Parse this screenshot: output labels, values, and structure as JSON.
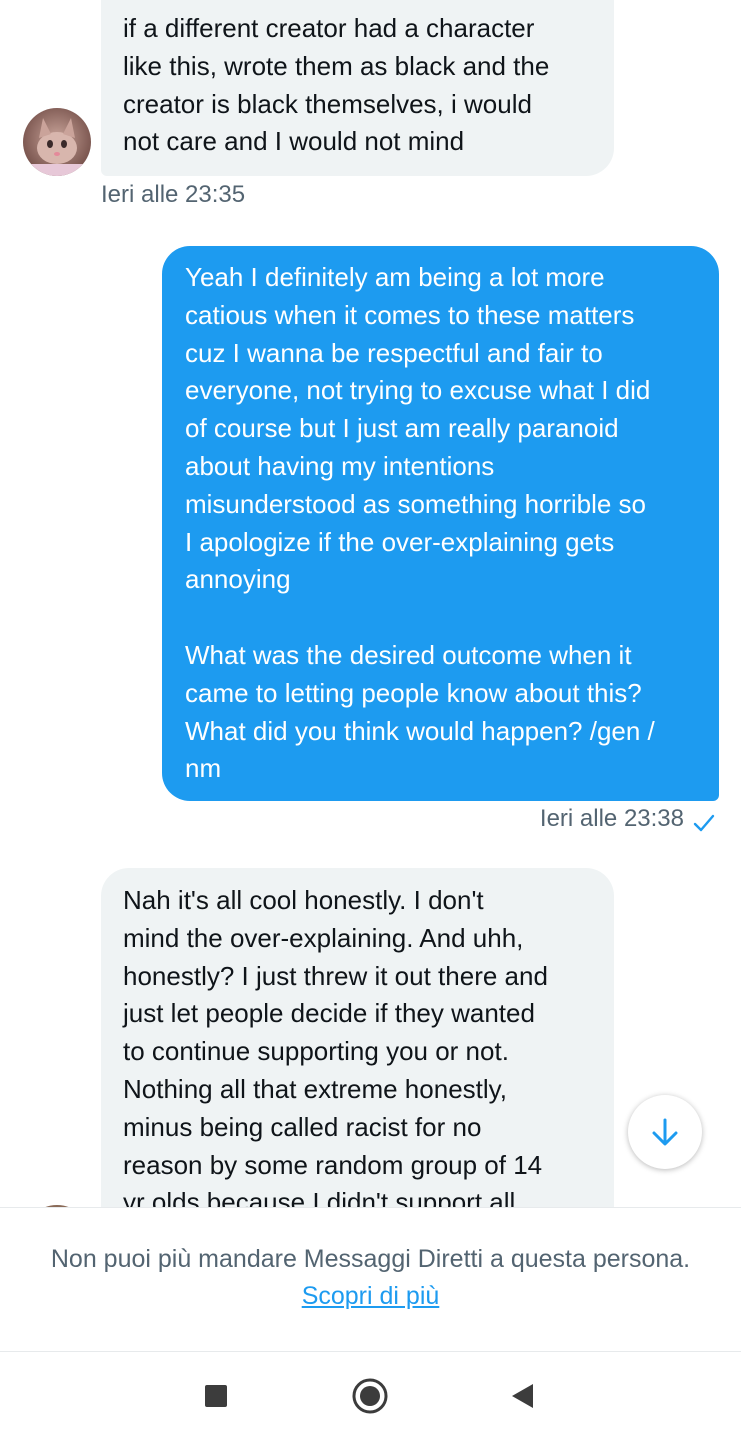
{
  "messages": [
    {
      "direction": "incoming",
      "text": "if a different creator had a character\nlike this, wrote them as black and the\ncreator is black themselves, i would\nnot care and I would not mind",
      "timestamp": "Ieri alle 23:35"
    },
    {
      "direction": "outgoing",
      "text": "Yeah I definitely am being a lot more\ncatious when it comes to these matters\ncuz I wanna be respectful and fair to\neveryone, not trying to excuse what I did\nof course but I just am really paranoid\nabout having my intentions\nmisunderstood as something horrible so\nI apologize if the over-explaining gets\nannoying\n\nWhat was the desired outcome when it\ncame to letting people know about this?\nWhat did you think would happen? /gen /\nnm",
      "timestamp": "Ieri alle 23:38",
      "status_icon": "check-icon"
    },
    {
      "direction": "incoming",
      "text": "Nah it's all cool honestly. I don't\nmind the over-explaining. And uhh,\nhonestly? I just threw it out there and\njust let people decide if they wanted\nto continue supporting you or not.\nNothing all that extreme honestly,\nminus being called racist for no\nreason by some random group of 14\nyr olds because I didn't support all"
    }
  ],
  "scroll_button_icon": "arrow-down-icon",
  "footer": {
    "notice": "Non puoi più mandare Messaggi Diretti a questa persona.",
    "link": "Scopri di più"
  },
  "navbar": {
    "icons": [
      "square-recents-icon",
      "circle-home-icon",
      "triangle-back-icon"
    ]
  },
  "colors": {
    "accent": "#1d9bf0",
    "incoming_bubble": "#eff3f4",
    "secondary_text": "#536471"
  }
}
